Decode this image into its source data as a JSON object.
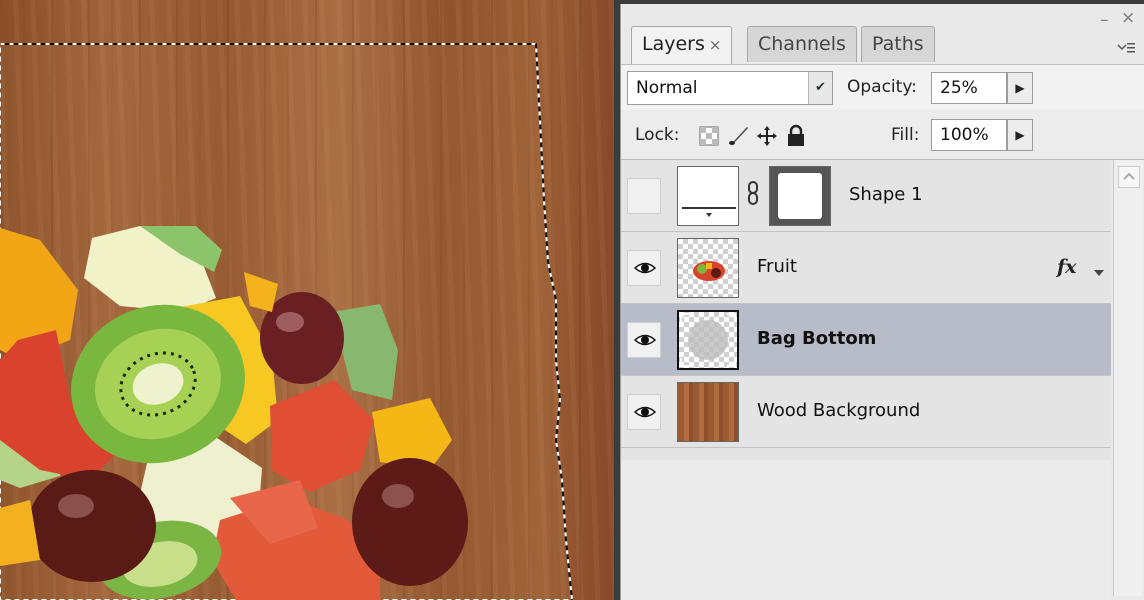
{
  "tabs": [
    {
      "label": "Layers",
      "close": "×",
      "active": true
    },
    {
      "label": "Channels",
      "active": false
    },
    {
      "label": "Paths",
      "active": false
    }
  ],
  "window_controls": {
    "minimize": "–",
    "close": "×"
  },
  "panel_menu_icon": "panel-menu-icon",
  "blend_mode": {
    "value": "Normal"
  },
  "opacity": {
    "label": "Opacity:",
    "value": "25%"
  },
  "lock": {
    "label": "Lock:",
    "icons": [
      "lock-transparent-icon",
      "lock-brush-icon",
      "lock-move-icon",
      "lock-all-icon"
    ]
  },
  "fill": {
    "label": "Fill:",
    "value": "100%"
  },
  "layers": [
    {
      "name": "Shape 1",
      "visible": false,
      "selected": false,
      "linked_mask": true,
      "fx": false
    },
    {
      "name": "Fruit",
      "visible": true,
      "selected": false,
      "linked_mask": false,
      "fx": true
    },
    {
      "name": "Bag Bottom",
      "visible": true,
      "selected": true,
      "linked_mask": false,
      "fx": false
    },
    {
      "name": "Wood Background",
      "visible": true,
      "selected": false,
      "linked_mask": false,
      "fx": false
    }
  ],
  "fx_label": "fx",
  "colors": {
    "highlight_ring": "#e9d463",
    "selected_row": "#b8bcc9",
    "wood": "#9a5a32"
  }
}
